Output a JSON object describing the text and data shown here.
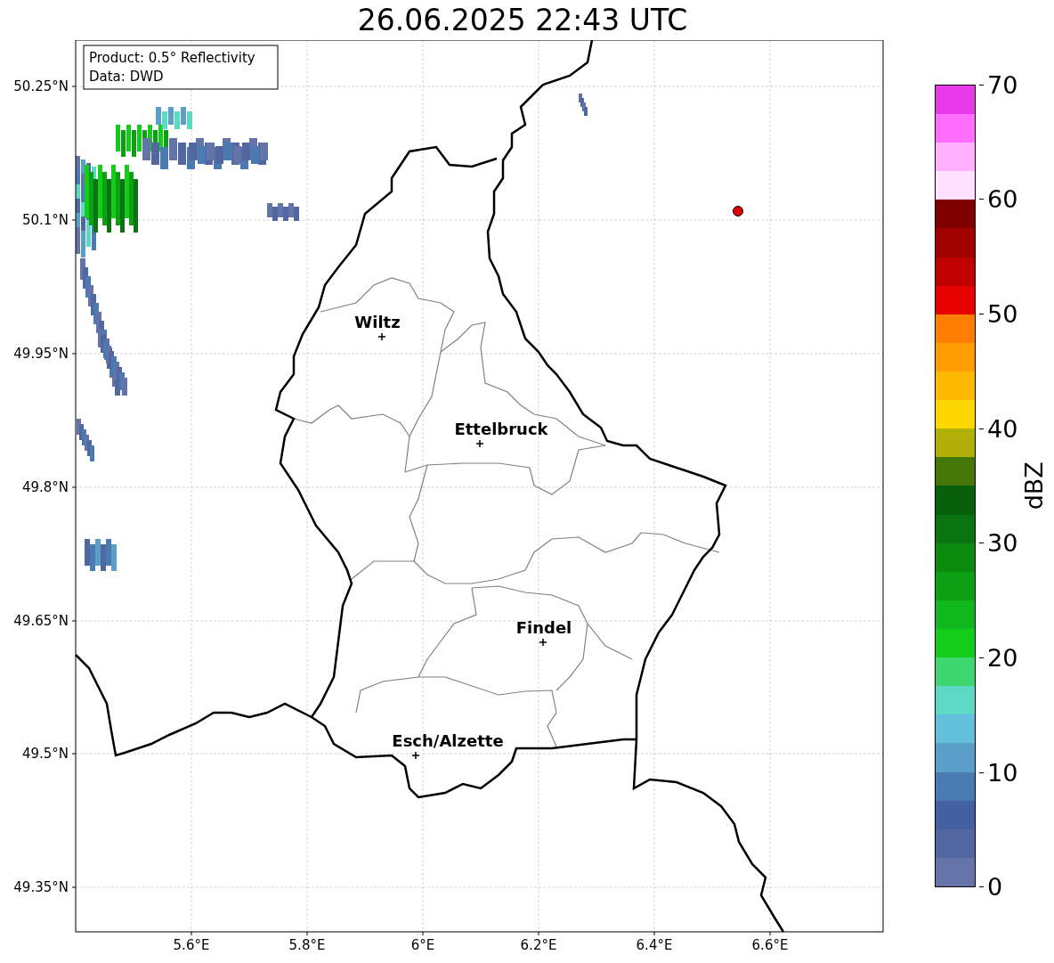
{
  "title": "26.06.2025 22:43 UTC",
  "info_box": {
    "lines": [
      "Product: 0.5° Reflectivity",
      "Data: DWD"
    ]
  },
  "cities": [
    {
      "name": "Wiltz"
    },
    {
      "name": "Ettelbruck"
    },
    {
      "name": "Findel"
    },
    {
      "name": "Esch/Alzette"
    }
  ],
  "x_ticks": [
    "5.6°E",
    "5.8°E",
    "6°E",
    "6.2°E",
    "6.4°E",
    "6.6°E"
  ],
  "y_ticks": [
    "50.25°N",
    "50.1°N",
    "49.95°N",
    "49.8°N",
    "49.65°N",
    "49.5°N",
    "49.35°N"
  ],
  "colorbar": {
    "label": "dBZ",
    "ticks": [
      "70",
      "60",
      "50",
      "40",
      "30",
      "20",
      "10",
      "0"
    ],
    "segments": [
      {
        "color": "#6574a8"
      },
      {
        "color": "#52669f"
      },
      {
        "color": "#4360a0"
      },
      {
        "color": "#4a7ab2"
      },
      {
        "color": "#5a9fc7"
      },
      {
        "color": "#62c0dc"
      },
      {
        "color": "#5dd8c4"
      },
      {
        "color": "#3dd66f"
      },
      {
        "color": "#13cd1a"
      },
      {
        "color": "#11b81d"
      },
      {
        "color": "#0ea013"
      },
      {
        "color": "#0b8a10"
      },
      {
        "color": "#0a7412"
      },
      {
        "color": "#075e0b"
      },
      {
        "color": "#457808"
      },
      {
        "color": "#b0b006"
      },
      {
        "color": "#ffd700"
      },
      {
        "color": "#ffb800"
      },
      {
        "color": "#ff9d00"
      },
      {
        "color": "#ff7e00"
      },
      {
        "color": "#e60000"
      },
      {
        "color": "#c00000"
      },
      {
        "color": "#a00000"
      },
      {
        "color": "#800000"
      },
      {
        "color": "#ffe0ff"
      },
      {
        "color": "#ffb0ff"
      },
      {
        "color": "#ff6eff"
      },
      {
        "color": "#e83ae8"
      }
    ]
  }
}
